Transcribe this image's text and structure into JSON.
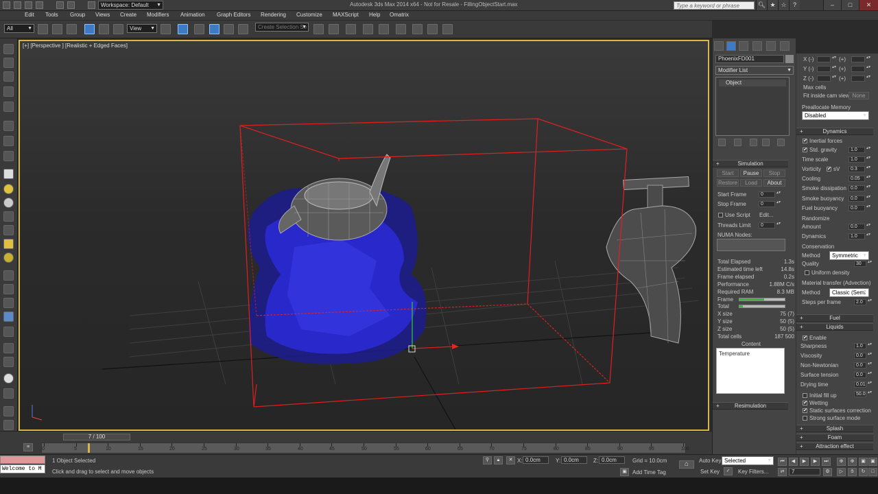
{
  "titlebar": {
    "workspace": "Workspace: Default",
    "title": "Autodesk 3ds Max 2014 x64 - Not for Resale - FillingObjectStart.max",
    "search_placeholder": "Type a keyword or phrase"
  },
  "menu": [
    "Edit",
    "Tools",
    "Group",
    "Views",
    "Create",
    "Modifiers",
    "Animation",
    "Graph Editors",
    "Rendering",
    "Customize",
    "MAXScript",
    "Help",
    "Omatrix"
  ],
  "toolbar": {
    "selection_filter": "All",
    "ref_coord": "View",
    "named_selection": "Create Selection Se"
  },
  "viewport": {
    "label": "[+] [Perspective ] [Realistic + Edged Faces]"
  },
  "command_panel": {
    "object_name": "PhoenixFD001",
    "modifier_list": "Modifier List",
    "stack_item": "Object",
    "simulation": {
      "title": "Simulation",
      "start": "Start",
      "pause": "Pause",
      "stop": "Stop",
      "restore": "Restore",
      "load": "Load",
      "about": "About",
      "start_frame_label": "Start Frame",
      "start_frame": "0",
      "stop_frame_label": "Stop Frame",
      "stop_frame": "0",
      "use_script": "Use Script",
      "edit": "Edit...",
      "threads_limit_label": "Threads Limit",
      "threads_limit": "0",
      "numa_label": "NUMA Nodes:",
      "stats": [
        {
          "label": "Total Elapsed",
          "value": "1.3s"
        },
        {
          "label": "Estimated time left",
          "value": "14.8s"
        },
        {
          "label": "Frame elapsed",
          "value": "0.2s"
        },
        {
          "label": "Performance",
          "value": "1.88M C/s"
        },
        {
          "label": "Required RAM",
          "value": "8.3 MB"
        }
      ],
      "frame_label": "Frame",
      "frame_progress": 0.55,
      "total_label": "Total",
      "total_progress": 0.07,
      "sizes": [
        {
          "label": "X size",
          "value": "75 (7)"
        },
        {
          "label": "Y size",
          "value": "50 (5)"
        },
        {
          "label": "Z size",
          "value": "50 (5)"
        },
        {
          "label": "Total cells",
          "value": "187 500"
        }
      ],
      "content_label": "Content",
      "content_item": "Temperature",
      "resimulation": "Resimulation"
    }
  },
  "right_panel": {
    "xyz": [
      {
        "label": "X (-)",
        "plus": "(+)"
      },
      {
        "label": "Y (-)",
        "plus": "(+)"
      },
      {
        "label": "Z (-)",
        "plus": "(+)"
      }
    ],
    "max_cells": "Max cells",
    "fit_cam": "Fit inside cam view",
    "fit_cam_btn": "None",
    "prealloc_label": "Preallocate Memory",
    "prealloc_value": "Disabled",
    "dynamics_title": "Dynamics",
    "inertial_forces": "Inertial forces",
    "std_gravity": "Std. gravity",
    "std_gravity_val": "1.0",
    "time_scale": "Time scale",
    "time_scale_val": "1.0",
    "vorticity": "Vorticity",
    "vorticity_sv": "sV",
    "vorticity_val": "0.3",
    "cooling": "Cooling",
    "cooling_val": "0.05",
    "smoke_dissipation": "Smoke dissipation",
    "smoke_dissipation_val": "0.0",
    "smoke_buoyancy": "Smoke buoyancy",
    "smoke_buoyancy_val": "0.0",
    "fuel_buoyancy": "Fuel buoyancy",
    "fuel_buoyancy_val": "0.0",
    "randomize": "Randomize",
    "amount": "Amount",
    "amount_val": "0.0",
    "dynamics_rand": "Dynamics",
    "dynamics_rand_val": "1.0",
    "conservation": "Conservation",
    "method": "Method",
    "method_val": "Symmetric",
    "quality": "Quality",
    "quality_val": "30",
    "uniform_density": "Uniform density",
    "material_transfer": "Material transfer (Advection)",
    "method2": "Method",
    "method2_val": "Classic (Semi",
    "steps_per_frame": "Steps per frame",
    "steps_per_frame_val": "2.0",
    "fuel_title": "Fuel",
    "liquids_title": "Liquids",
    "enable": "Enable",
    "sharpness": "Sharpness",
    "sharpness_val": "1.0",
    "viscosity": "Viscosity",
    "viscosity_val": "0.0",
    "non_newtonian": "Non-Newtonian",
    "non_newtonian_val": "0.0",
    "surface_tension": "Surface tension",
    "surface_tension_val": "0.0",
    "drying_time": "Drying time",
    "drying_time_val": "0.01",
    "initial_fill_up": "Initial fill up",
    "initial_fill_up_val": "50.0",
    "wetting": "Wetting",
    "static_surfaces": "Static surfaces correction",
    "strong_surface": "Strong surface mode",
    "splash": "Splash",
    "foam": "Foam",
    "attraction": "Attraction effect"
  },
  "timeline": {
    "slider": "7 / 100",
    "current_frame": 7,
    "ticks": [
      "0",
      "5",
      "10",
      "15",
      "20",
      "25",
      "30",
      "35",
      "40",
      "45",
      "50",
      "55",
      "60",
      "65",
      "70",
      "75",
      "80",
      "85",
      "90",
      "95",
      "100"
    ]
  },
  "status": {
    "listener": "Welcome to M",
    "selected": "1 Object Selected",
    "prompt": "Click and drag to select and move objects",
    "x_label": "X:",
    "x_val": "0.0cm",
    "y_label": "Y:",
    "y_val": "0.0cm",
    "z_label": "Z:",
    "z_val": "0.0cm",
    "grid": "Grid = 10.0cm",
    "add_time_tag": "Add Time Tag",
    "auto_key": "Auto Key",
    "set_key": "Set Key",
    "key_mode": "Selected",
    "key_filters": "Key Filters...",
    "frame": "7"
  },
  "colors": {
    "viewport_border": "#d8b64a",
    "grid_box": "#e02020",
    "liquid": "#2a2ad8",
    "selection_blue": "#3d7bc4"
  }
}
